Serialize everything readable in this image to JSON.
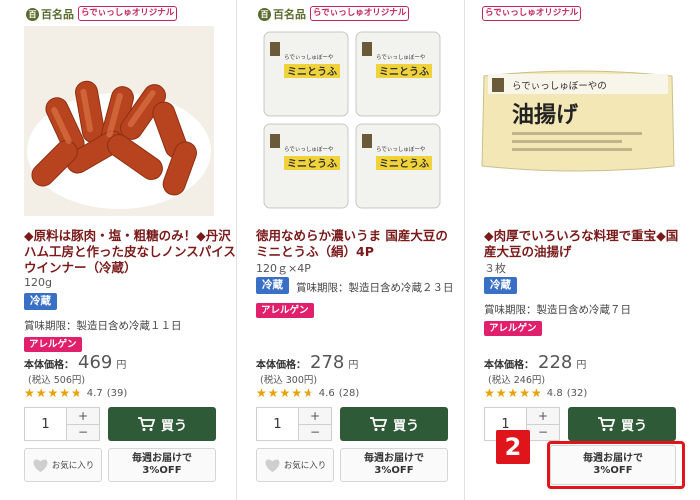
{
  "colors": {
    "brand_green": "#2f5a38",
    "title_maroon": "#7a1a1a",
    "cold_tag": "#3a6fc6",
    "allergen_tag": "#e0206c",
    "star": "#e8a300",
    "highlight": "#e0141b"
  },
  "badges": {
    "hyakumeihin": "百名品",
    "original": "らでぃっしゅオリジナル"
  },
  "products": [
    {
      "title": "◆原料は豚肉・塩・粗糖のみ！◆丹沢ハム工房と作った皮なしノンスパイスウインナー（冷蔵）",
      "quantity": "120g",
      "storage": "冷蔵",
      "expiry": "賞味期限：製造日含め冷蔵１１日",
      "allergen": "アレルゲン",
      "price_label": "本体価格：",
      "price": "469",
      "yen": "円",
      "tax_incl": "(税込 506円)",
      "rating": 4.7,
      "rating_text": "4.7",
      "review_count": "(39)",
      "qty_value": "1",
      "buy_label": "買う",
      "fav_label": "お気に入り",
      "sub_line1": "毎週お届けで",
      "sub_line2": "3%OFF"
    },
    {
      "title": "徳用なめらか濃いうま 国産大豆のミニとうふ（絹）4P",
      "quantity": "120ｇ×4P",
      "storage": "冷蔵",
      "expiry": "賞味期限：製造日含め冷蔵２３日",
      "allergen": "アレルゲン",
      "price_label": "本体価格：",
      "price": "278",
      "yen": "円",
      "tax_incl": "(税込 300円)",
      "rating": 4.6,
      "rating_text": "4.6",
      "review_count": "(28)",
      "qty_value": "1",
      "buy_label": "買う",
      "fav_label": "お気に入り",
      "sub_line1": "毎週お届けで",
      "sub_line2": "3%OFF",
      "package_brand": "らでぃっしゅぼーや",
      "package_label": "ミニとうふ"
    },
    {
      "title": "◆肉厚でいろいろな料理で重宝◆国産大豆の油揚げ",
      "quantity": "３枚",
      "storage": "冷蔵",
      "expiry": "賞味期限：製造日含め冷蔵７日",
      "allergen": "アレルゲン",
      "price_label": "本体価格：",
      "price": "228",
      "yen": "円",
      "tax_incl": "(税込 246円)",
      "rating": 4.8,
      "rating_text": "4.8",
      "review_count": "(32)",
      "qty_value": "1",
      "buy_label": "買う",
      "sub_line1": "毎週お届けで",
      "sub_line2": "3%OFF",
      "package_brand": "らでぃっしゅぼーやの",
      "package_label": "油揚げ"
    }
  ],
  "qty_plus": "+",
  "qty_minus": "−",
  "stars_glyph": "★★★★★",
  "step_marker": "2"
}
